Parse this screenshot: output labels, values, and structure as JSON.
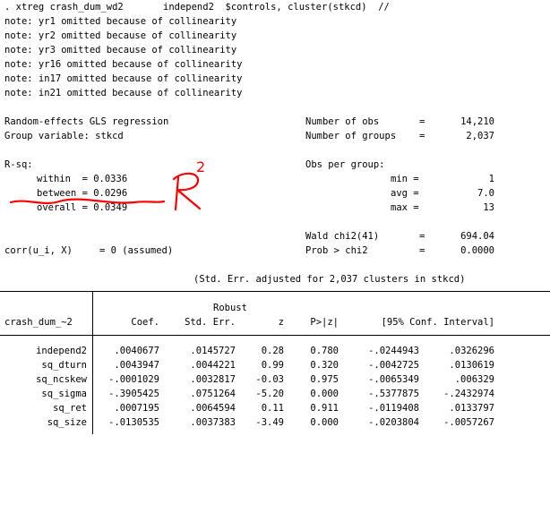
{
  "command": ". xtreg crash_dum_wd2       independ2  $controls, cluster(stkcd)  //",
  "notes": [
    "note: yr1 omitted because of collinearity",
    "note: yr2 omitted because of collinearity",
    "note: yr3 omitted because of collinearity",
    "note: yr16 omitted because of collinearity",
    "note: in17 omitted because of collinearity",
    "note: in21 omitted because of collinearity"
  ],
  "header": {
    "title": "Random-effects GLS regression",
    "group_var": "Group variable: stkcd",
    "nobs_label": "Number of obs",
    "nobs_value": "14,210",
    "ngroups_label": "Number of groups",
    "ngroups_value": "2,037",
    "rsq_label": "R-sq:",
    "obs_per_group": "Obs per group:",
    "within": "within  = 0.0336",
    "between": "between = 0.0296",
    "overall": "overall = 0.0349",
    "min_label": "min =",
    "min_value": "1",
    "avg_label": "avg =",
    "avg_value": "7.0",
    "max_label": "max =",
    "max_value": "13",
    "wald_label": "Wald chi2(41)",
    "wald_value": "694.04",
    "corr_label": "corr(u_i, X)",
    "corr_value": "= 0 (assumed)",
    "prob_label": "Prob > chi2",
    "prob_value": "0.0000",
    "eq": "=",
    "stderr_note": "(Std. Err. adjusted for 2,037 clusters in stkcd)"
  },
  "table": {
    "robust": "Robust",
    "depvar": "crash_dum_~2",
    "columns": [
      "Coef.",
      "Std. Err.",
      "z",
      "P>|z|",
      "[95% Conf. Interval]"
    ],
    "rows": [
      {
        "name": "independ2",
        "coef": ".0040677",
        "se": ".0145727",
        "z": "0.28",
        "p": "0.780",
        "lo": "-.0244943",
        "hi": ".0326296"
      },
      {
        "name": "sq_dturn",
        "coef": ".0043947",
        "se": ".0044221",
        "z": "0.99",
        "p": "0.320",
        "lo": "-.0042725",
        "hi": ".0130619"
      },
      {
        "name": "sq_ncskew",
        "coef": "-.0001029",
        "se": ".0032817",
        "z": "-0.03",
        "p": "0.975",
        "lo": "-.0065349",
        "hi": ".006329"
      },
      {
        "name": "sq_sigma",
        "coef": "-.3905425",
        "se": ".0751264",
        "z": "-5.20",
        "p": "0.000",
        "lo": "-.5377875",
        "hi": "-.2432974"
      },
      {
        "name": "sq_ret",
        "coef": ".0007195",
        "se": ".0064594",
        "z": "0.11",
        "p": "0.911",
        "lo": "-.0119408",
        "hi": ".0133797"
      },
      {
        "name": "sq_size",
        "coef": "-.0130535",
        "se": ".0037383",
        "z": "-3.49",
        "p": "0.000",
        "lo": "-.0203804",
        "hi": "-.0057267"
      }
    ]
  },
  "annotation": {
    "letter": "R",
    "superscript": "2",
    "color": "#ff0000"
  }
}
